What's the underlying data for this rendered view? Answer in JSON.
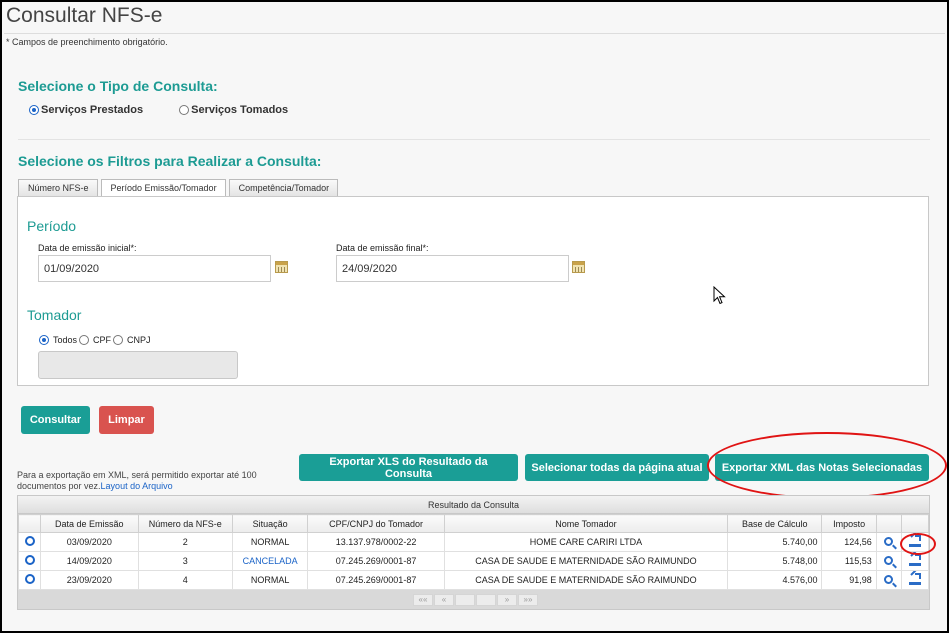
{
  "page": {
    "title": "Consultar NFS-e",
    "required_note": "* Campos de preenchimento obrigatório."
  },
  "consulta_tipo": {
    "heading": "Selecione o Tipo de Consulta:",
    "options": [
      {
        "label": "Serviços Prestados",
        "checked": true
      },
      {
        "label": "Serviços Tomados",
        "checked": false
      }
    ]
  },
  "filtros": {
    "heading": "Selecione os Filtros para Realizar a Consulta:",
    "tabs": [
      {
        "label": "Número NFS-e",
        "active": false
      },
      {
        "label": "Período Emissão/Tomador",
        "active": true
      },
      {
        "label": "Competência/Tomador",
        "active": false
      }
    ],
    "periodo": {
      "heading": "Período",
      "inicial_label": "Data de emissão inicial*:",
      "inicial_value": "01/09/2020",
      "final_label": "Data de emissão final*:",
      "final_value": "24/09/2020"
    },
    "tomador": {
      "heading": "Tomador",
      "options": [
        {
          "label": "Todos",
          "checked": true
        },
        {
          "label": "CPF",
          "checked": false
        },
        {
          "label": "CNPJ",
          "checked": false
        }
      ]
    }
  },
  "actions": {
    "consultar": "Consultar",
    "limpar": "Limpar",
    "export_xls": "Exportar XLS do Resultado da Consulta",
    "select_all": "Selecionar todas da página atual",
    "export_xml": "Exportar XML das Notas Selecionadas"
  },
  "export_note": {
    "text": "Para a exportação em XML, será permitido exportar até 100 documentos por vez.",
    "link": "Layout do Arquivo"
  },
  "results": {
    "caption": "Resultado da Consulta",
    "columns": [
      "",
      "Data de Emissão",
      "Número da NFS-e",
      "Situação",
      "CPF/CNPJ do Tomador",
      "Nome Tomador",
      "Base de Cálculo",
      "Imposto",
      "",
      ""
    ],
    "rows": [
      {
        "data": "03/09/2020",
        "numero": "2",
        "situacao": "NORMAL",
        "cpf_cnpj": "13.137.978/0002-22",
        "nome": "HOME CARE CARIRI LTDA",
        "base": "5.740,00",
        "imposto": "124,56"
      },
      {
        "data": "14/09/2020",
        "numero": "3",
        "situacao": "CANCELADA",
        "cpf_cnpj": "07.245.269/0001-87",
        "nome": "CASA DE SAUDE E MATERNIDADE SÃO RAIMUNDO",
        "base": "5.748,00",
        "imposto": "115,53"
      },
      {
        "data": "23/09/2020",
        "numero": "4",
        "situacao": "NORMAL",
        "cpf_cnpj": "07.245.269/0001-87",
        "nome": "CASA DE SAUDE E MATERNIDADE SÃO RAIMUNDO",
        "base": "4.576,00",
        "imposto": "91,98"
      }
    ],
    "pager": [
      "««",
      "«",
      "",
      "",
      "»",
      "»»"
    ]
  },
  "colors": {
    "accent": "#1a9e96",
    "danger": "#d9534f",
    "link": "#1a63c7",
    "annotation": "#e01414"
  }
}
